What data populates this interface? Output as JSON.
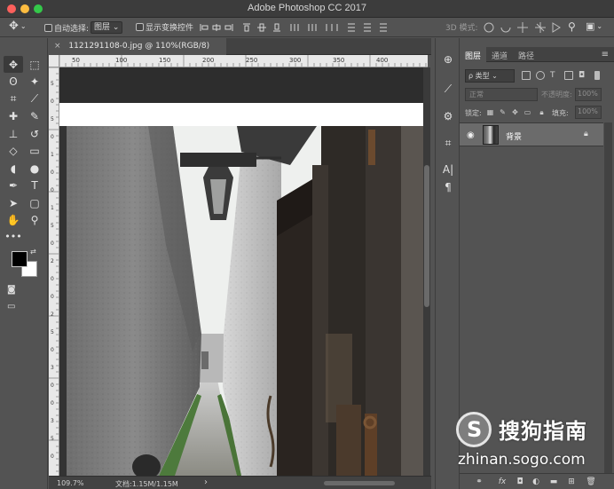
{
  "window": {
    "title": "Adobe Photoshop CC 2017",
    "traffic_colors": [
      "#fc605c",
      "#fdbc40",
      "#34c84a"
    ]
  },
  "options_bar": {
    "auto_select_label": "自动选择:",
    "auto_select_value": "图层",
    "show_transform_label": "显示变换控件",
    "mode_3d_label": "3D 模式:"
  },
  "document": {
    "tab_title": "1121291108-0.jpg @ 110%(RGB/8)",
    "close_glyph": "×"
  },
  "ruler": {
    "h_labels": [
      "50",
      "100",
      "150",
      "200",
      "250",
      "300",
      "350",
      "400"
    ],
    "v_labels": [
      "5",
      "0",
      "5",
      "0",
      "1",
      "0",
      "0",
      "1",
      "5",
      "0",
      "2",
      "0",
      "0",
      "2",
      "5",
      "0",
      "3",
      "0",
      "0",
      "3",
      "5",
      "0"
    ]
  },
  "status": {
    "zoom": "109.7%",
    "doc_info": "文档:1.15M/1.15M",
    "arrow": "›"
  },
  "panel": {
    "tabs": [
      "图层",
      "通道",
      "路径"
    ],
    "active_tab": "图层",
    "menu_glyph": "≡",
    "filter_label": "ρ 类型",
    "blend_mode": "正常",
    "opacity_label": "不透明度:",
    "opacity_value": "100%",
    "lock_label": "锁定:",
    "fill_label": "填充:",
    "fill_value": "100%"
  },
  "layers": [
    {
      "name": "背景",
      "visible": true,
      "locked": true
    }
  ],
  "tools": [
    {
      "name": "move-tool",
      "glyph": "✥"
    },
    {
      "name": "marquee-tool",
      "glyph": "⬚"
    },
    {
      "name": "lasso-tool",
      "glyph": "ʘ"
    },
    {
      "name": "magic-wand-tool",
      "glyph": "✦"
    },
    {
      "name": "crop-tool",
      "glyph": "⌗"
    },
    {
      "name": "eyedropper-tool",
      "glyph": "⟋"
    },
    {
      "name": "healing-brush-tool",
      "glyph": "✚"
    },
    {
      "name": "brush-tool",
      "glyph": "✎"
    },
    {
      "name": "clone-stamp-tool",
      "glyph": "⊥"
    },
    {
      "name": "history-brush-tool",
      "glyph": "↺"
    },
    {
      "name": "eraser-tool",
      "glyph": "◇"
    },
    {
      "name": "gradient-tool",
      "glyph": "▭"
    },
    {
      "name": "blur-tool",
      "glyph": "◖"
    },
    {
      "name": "dodge-tool",
      "glyph": "●"
    },
    {
      "name": "pen-tool",
      "glyph": "✒"
    },
    {
      "name": "type-tool",
      "glyph": "T"
    },
    {
      "name": "path-selection-tool",
      "glyph": "➤"
    },
    {
      "name": "shape-tool",
      "glyph": "▢"
    },
    {
      "name": "hand-tool",
      "glyph": "✋"
    },
    {
      "name": "zoom-tool",
      "glyph": "⚲"
    }
  ],
  "colors": {
    "foreground": "#000000",
    "background": "#ffffff",
    "accent_panel": "#535353",
    "selected_layer": "#6b6b6b"
  },
  "watermark": {
    "logo_letter": "S",
    "brand": "搜狗指南",
    "url": "zhinan.sogo.com"
  }
}
